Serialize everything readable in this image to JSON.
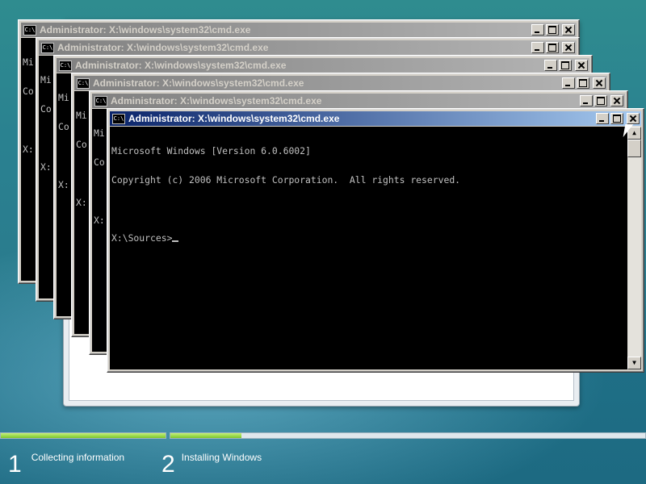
{
  "windows": [
    {
      "title": "Administrator: X:\\windows\\system32\\cmd.exe",
      "lines": [
        "Mi",
        "Co",
        "",
        "X:"
      ]
    },
    {
      "title": "Administrator: X:\\windows\\system32\\cmd.exe",
      "lines": [
        "Mi",
        "Co",
        "",
        "X:"
      ]
    },
    {
      "title": "Administrator: X:\\windows\\system32\\cmd.exe",
      "lines": [
        "Mi",
        "Co",
        "",
        "X:"
      ]
    },
    {
      "title": "Administrator: X:\\windows\\system32\\cmd.exe",
      "lines": [
        "Mi",
        "Co",
        "",
        "X:"
      ]
    },
    {
      "title": "Administrator: X:\\windows\\system32\\cmd.exe",
      "lines": [
        "Mi",
        "Co",
        "",
        "X:"
      ]
    },
    {
      "title": "Administrator: X:\\windows\\system32\\cmd.exe",
      "lines": [
        "Microsoft Windows [Version 6.0.6002]",
        "Copyright (c) 2006 Microsoft Corporation.  All rights reserved.",
        "",
        "X:\\Sources>"
      ]
    }
  ],
  "setup": {
    "steps": [
      {
        "number": "1",
        "label": "Collecting information",
        "progress": 1.0
      },
      {
        "number": "2",
        "label": "Installing Windows",
        "progress": 0.15
      }
    ]
  },
  "icons": {
    "app": "cmd-app-icon",
    "minimize": "minimize-icon",
    "maximize": "maximize-icon",
    "close": "close-icon"
  },
  "colors": {
    "console_bg": "#000000",
    "console_fg": "#c0c0c0",
    "active_title": "#0a246a",
    "progress_fill": "#7cc62c"
  }
}
